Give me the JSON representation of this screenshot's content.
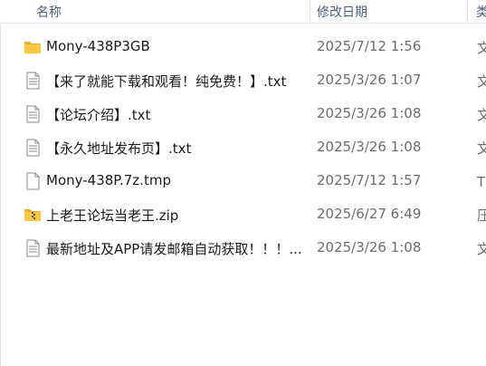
{
  "columns": {
    "name": "名称",
    "date_modified": "修改日期",
    "type": "类型"
  },
  "files": [
    {
      "name": "Mony-438P3GB",
      "date": "2025/7/12 1:56",
      "type": "文件夹",
      "icon": "folder-icon"
    },
    {
      "name": "【来了就能下载和观看！纯免费！】.txt",
      "date": "2025/3/26 1:07",
      "type": "文本文档",
      "icon": "text-file-icon"
    },
    {
      "name": "【论坛介绍】.txt",
      "date": "2025/3/26 1:08",
      "type": "文本文档",
      "icon": "text-file-icon"
    },
    {
      "name": "【永久地址发布页】.txt",
      "date": "2025/3/26 1:08",
      "type": "文本文档",
      "icon": "text-file-icon"
    },
    {
      "name": "Mony-438P.7z.tmp",
      "date": "2025/7/12 1:57",
      "type": "TMP 文件",
      "icon": "blank-file-icon"
    },
    {
      "name": "上老王论坛当老王.zip",
      "date": "2025/6/27 6:49",
      "type": "压缩文件",
      "icon": "zip-folder-icon"
    },
    {
      "name": "最新地址及APP请发邮箱自动获取！！！...",
      "date": "2025/3/26 1:08",
      "type": "文本文档",
      "icon": "text-file-icon"
    }
  ],
  "colors": {
    "folder": "#f8c93e",
    "header_text": "#4c607a",
    "date_text": "#6d6d6d"
  }
}
